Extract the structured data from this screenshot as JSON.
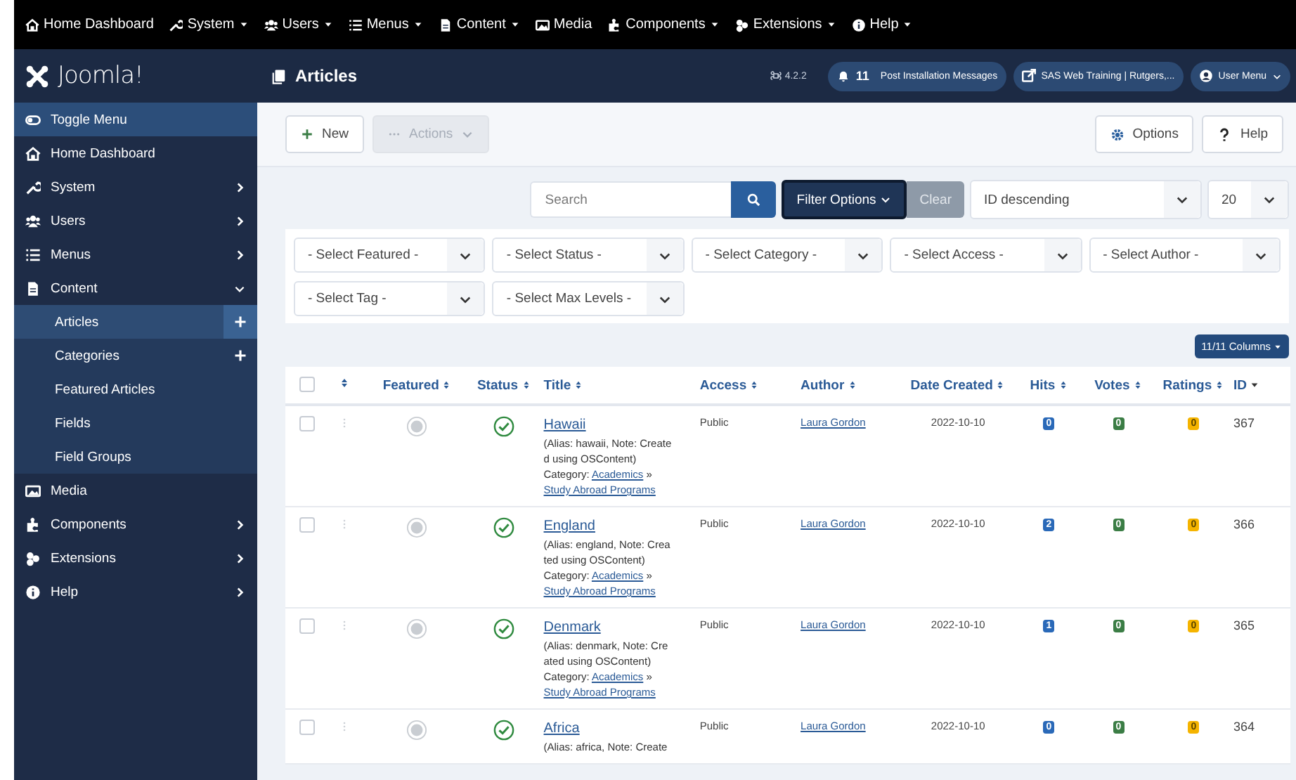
{
  "topbar": {
    "items": [
      {
        "label": "Home Dashboard",
        "has_caret": false
      },
      {
        "label": "System",
        "has_caret": true
      },
      {
        "label": "Users",
        "has_caret": true
      },
      {
        "label": "Menus",
        "has_caret": true
      },
      {
        "label": "Content",
        "has_caret": true
      },
      {
        "label": "Media",
        "has_caret": false
      },
      {
        "label": "Components",
        "has_caret": true
      },
      {
        "label": "Extensions",
        "has_caret": true
      },
      {
        "label": "Help",
        "has_caret": true
      }
    ]
  },
  "logo": {
    "text": "Joomla!"
  },
  "sidebar": {
    "items": [
      {
        "kind": "toggle",
        "label": "Toggle Menu"
      },
      {
        "kind": "item",
        "label": "Home Dashboard",
        "expandable": false
      },
      {
        "kind": "item",
        "label": "System",
        "expandable": true,
        "expanded": false
      },
      {
        "kind": "item",
        "label": "Users",
        "expandable": true,
        "expanded": false
      },
      {
        "kind": "item",
        "label": "Menus",
        "expandable": true,
        "expanded": false
      },
      {
        "kind": "item",
        "label": "Content",
        "expandable": true,
        "expanded": true,
        "children": [
          {
            "label": "Articles",
            "selected": true,
            "has_plus": true
          },
          {
            "label": "Categories",
            "selected": false,
            "has_plus": true
          },
          {
            "label": "Featured Articles",
            "selected": false,
            "has_plus": false
          },
          {
            "label": "Fields",
            "selected": false,
            "has_plus": false
          },
          {
            "label": "Field Groups",
            "selected": false,
            "has_plus": false
          }
        ]
      },
      {
        "kind": "item",
        "label": "Media",
        "expandable": false
      },
      {
        "kind": "item",
        "label": "Components",
        "expandable": true,
        "expanded": false
      },
      {
        "kind": "item",
        "label": "Extensions",
        "expandable": true,
        "expanded": false
      },
      {
        "kind": "item",
        "label": "Help",
        "expandable": true,
        "expanded": false
      }
    ]
  },
  "header": {
    "title": "Articles",
    "version": "4.2.2",
    "notification_count": "11",
    "notification_label": "Post Installation Messages",
    "site": "SAS Web Training | Rutgers,...",
    "user_menu": "User Menu"
  },
  "toolbar": {
    "left": [
      {
        "kind": "new",
        "label": "New",
        "disabled": false
      },
      {
        "kind": "actions",
        "label": "Actions",
        "disabled": true
      }
    ],
    "right": [
      {
        "kind": "options",
        "label": "Options"
      },
      {
        "kind": "help",
        "label": "Help"
      }
    ]
  },
  "search": {
    "placeholder": "Search"
  },
  "filter_options": "Filter Options",
  "clear": "Clear",
  "ordering": "ID descending",
  "limit": "20",
  "filters": [
    "- Select Featured -",
    "- Select Status -",
    "- Select Category -",
    "- Select Access -",
    "- Select Author -",
    "- Select Tag -",
    "- Select Max Levels -"
  ],
  "columns_button": "11/11 Columns",
  "table": {
    "all_checked": false,
    "columns": [
      {
        "label": "Featured",
        "sorted": false
      },
      {
        "label": "Status",
        "sorted": false
      },
      {
        "label": "Title",
        "sorted": false
      },
      {
        "label": "Access",
        "sorted": false
      },
      {
        "label": "Author",
        "sorted": false
      },
      {
        "label": "Date Created",
        "sorted": false
      },
      {
        "label": "Hits",
        "sorted": false
      },
      {
        "label": "Votes",
        "sorted": false
      },
      {
        "label": "Ratings",
        "sorted": false
      },
      {
        "label": "ID",
        "sorted": true
      }
    ],
    "rows": [
      {
        "checked": false,
        "featured": false,
        "published": true,
        "title": "Hawaii",
        "note": "(Alias: hawaii, Note: Created using OSContent)",
        "category_label": "Category:",
        "category_parent": "Academics",
        "category_sep": "»",
        "category": "Study Abroad Programs",
        "access": "Public",
        "author": "Laura Gordon",
        "date": "2022-10-10",
        "hits": "0",
        "votes": "0",
        "ratings": "0",
        "id": "367"
      },
      {
        "checked": false,
        "featured": false,
        "published": true,
        "title": "England",
        "note": "(Alias: england, Note: Created using OSContent)",
        "category_label": "Category:",
        "category_parent": "Academics",
        "category_sep": "»",
        "category": "Study Abroad Programs",
        "access": "Public",
        "author": "Laura Gordon",
        "date": "2022-10-10",
        "hits": "2",
        "votes": "0",
        "ratings": "0",
        "id": "366"
      },
      {
        "checked": false,
        "featured": false,
        "published": true,
        "title": "Denmark",
        "note": "(Alias: denmark, Note: Created using OSContent)",
        "category_label": "Category:",
        "category_parent": "Academics",
        "category_sep": "»",
        "category": "Study Abroad Programs",
        "access": "Public",
        "author": "Laura Gordon",
        "date": "2022-10-10",
        "hits": "1",
        "votes": "0",
        "ratings": "0",
        "id": "365"
      },
      {
        "checked": false,
        "featured": false,
        "published": true,
        "title": "Africa",
        "note": "(Alias: africa, Note: Create",
        "access": "Public",
        "author": "Laura Gordon",
        "date": "2022-10-10",
        "hits": "0",
        "votes": "0",
        "ratings": "0",
        "id": "364"
      }
    ]
  }
}
